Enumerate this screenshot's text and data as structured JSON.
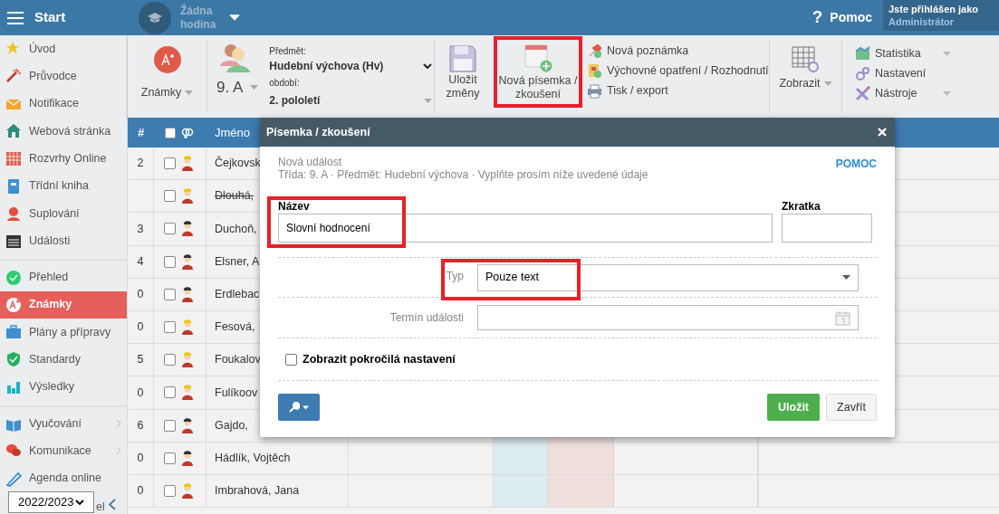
{
  "topbar": {
    "menu_label": "Start",
    "lesson": "Žádna hodina",
    "help_icon": "?",
    "help": "Pomoc",
    "login_caption": "Jste přihlášen jako",
    "user": "Administrátor"
  },
  "sidebar": {
    "sections": [
      {
        "items": [
          {
            "label": "Úvod",
            "selected": false
          },
          {
            "label": "Průvodce",
            "selected": false
          },
          {
            "label": "Notifikace",
            "selected": false
          },
          {
            "label": "Webová stránka",
            "selected": false
          },
          {
            "label": "Rozvrhy Online",
            "selected": false
          },
          {
            "label": "Třídní kniha",
            "selected": false
          },
          {
            "label": "Suplování",
            "selected": false
          },
          {
            "label": "Události",
            "selected": false
          }
        ]
      },
      {
        "items": [
          {
            "label": "Přehled",
            "selected": false
          },
          {
            "label": "Známky",
            "selected": true
          },
          {
            "label": "Plány a přípravy",
            "selected": false
          },
          {
            "label": "Standardy",
            "selected": false
          },
          {
            "label": "Výsledky",
            "selected": false
          }
        ]
      },
      {
        "items": [
          {
            "label": "Vyučování",
            "selected": false,
            "submenu": true
          },
          {
            "label": "Komunikace",
            "selected": false,
            "submenu": true
          },
          {
            "label": "Agenda online",
            "selected": false,
            "submenu": false
          }
        ]
      }
    ],
    "hidden_label": "el",
    "year_select": "2022/2023"
  },
  "toolbar": {
    "module": "Známky",
    "class": "9. A",
    "subject_label": "Předmět:",
    "subject": "Hudební výchova (Hv)",
    "period_label": "období:",
    "period": "2. pololetí",
    "save": "Uložit změny",
    "new_exam": {
      "label": "Nová písemka / zkoušení",
      "highlighted": true
    },
    "actions": [
      "Nová poznámka",
      "Výchovné opatření / Rozhodnutí",
      "Tisk / export"
    ],
    "view": "Zobrazit",
    "menus": [
      "Statistika",
      "Nastavení",
      "Nástroje"
    ]
  },
  "table": {
    "columns": [
      "#",
      "Jméno"
    ],
    "header_checked": false,
    "rows": [
      {
        "number": "2",
        "female": true,
        "name": "Čejkovsk",
        "checked": false,
        "struck": false
      },
      {
        "female": true,
        "name": "Dlouhá,",
        "checked": false,
        "struck": true
      },
      {
        "number": "3",
        "female": false,
        "name": "Duchoň,",
        "checked": false,
        "struck": false
      },
      {
        "number": "4",
        "female": false,
        "name": "Elsner, A",
        "checked": false,
        "struck": false
      },
      {
        "number": "0",
        "female": false,
        "name": "Erdlebac",
        "checked": false,
        "struck": false
      },
      {
        "number": "0",
        "female": true,
        "name": "Fesová,",
        "checked": false,
        "struck": false
      },
      {
        "number": "5",
        "female": true,
        "name": "Foukalov",
        "checked": false,
        "struck": false
      },
      {
        "number": "0",
        "female": true,
        "name": "Fulíkoov",
        "checked": false,
        "struck": false
      },
      {
        "number": "6",
        "female": false,
        "name": "Gajdo,",
        "checked": false,
        "struck": false
      },
      {
        "number": "0",
        "female": false,
        "name": "Hádlík, Vojtěch",
        "checked": false,
        "struck": false
      },
      {
        "number": "0",
        "female": true,
        "name": "Imbrahová, Jana",
        "checked": false,
        "struck": false
      }
    ]
  },
  "modal": {
    "title": "Písemka / zkoušení",
    "help": "POMOC",
    "subtitle": "Nová událost",
    "info": "Třída: 9. A · Předmět: Hudební výchova · Vyplňte prosím níže uvedené údaje",
    "name": {
      "label": "Název",
      "value": "Slovní hodnocení",
      "highlighted": true
    },
    "abbreviation": {
      "label": "Zkratka"
    },
    "type": {
      "label": "Typ",
      "value": "Pouze text",
      "highlighted": true
    },
    "date": {
      "label": "Termín události"
    },
    "advanced": {
      "label": "Zobrazit pokročilá nastavení",
      "checked": false
    },
    "save": "Uložit",
    "close": "Zavřít"
  }
}
